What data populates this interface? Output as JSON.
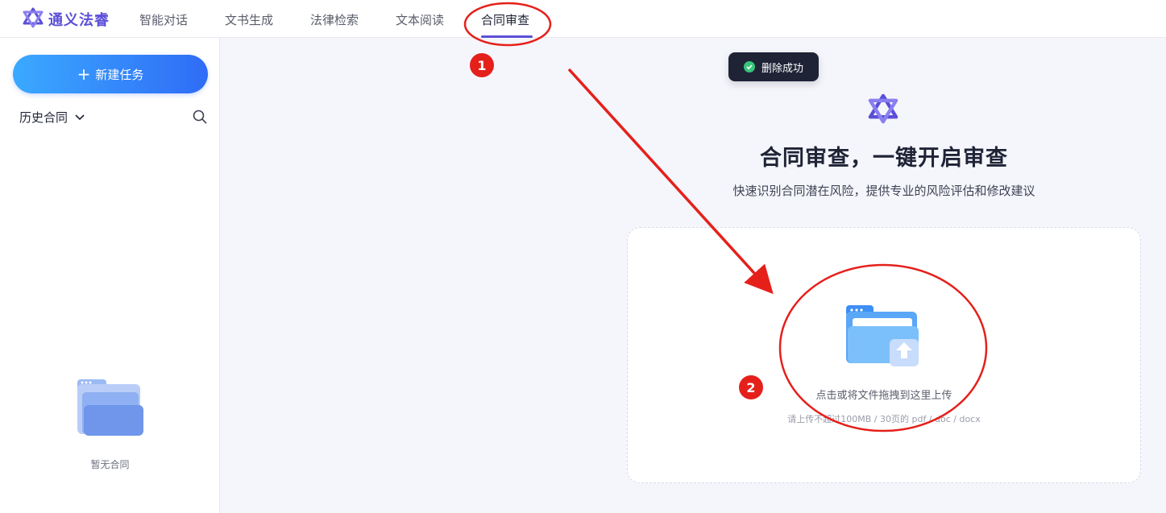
{
  "brand": {
    "name": "通义法睿",
    "logo_icon": "tongyi-logo-icon",
    "color": "#5b4fd8"
  },
  "nav": {
    "tabs": [
      {
        "label": "智能对话"
      },
      {
        "label": "文书生成"
      },
      {
        "label": "法律检索"
      },
      {
        "label": "文本阅读"
      },
      {
        "label": "合同审查",
        "active": true
      }
    ]
  },
  "sidebar": {
    "new_task_label": "新建任务",
    "history_label": "历史合同",
    "empty_text": "暂无合同"
  },
  "toast": {
    "text": "删除成功",
    "status_color": "#37c57a"
  },
  "main": {
    "title": "合同审查，一键开启审查",
    "subtitle": "快速识别合同潜在风险，提供专业的风险评估和修改建议",
    "upload_label": "点击或将文件拖拽到这里上传",
    "upload_hint": "请上传不超过100MB / 30页的 pdf / doc / docx"
  },
  "annotations": {
    "badge_1": "1",
    "badge_2": "2",
    "color": "#e5201b"
  }
}
